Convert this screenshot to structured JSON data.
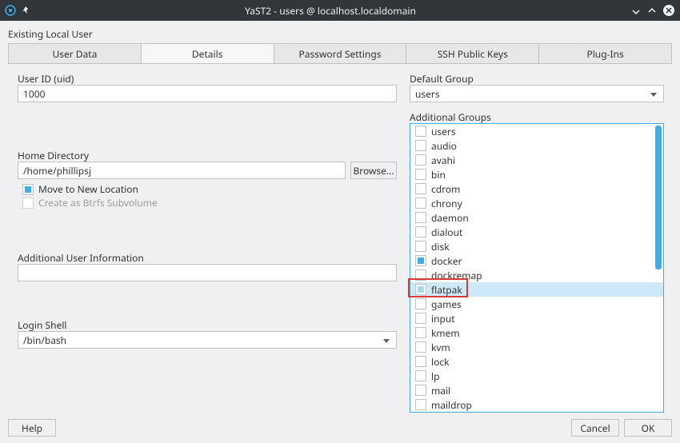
{
  "window": {
    "title": "YaST2 - users @ localhost.localdomain"
  },
  "header": "Existing Local User",
  "tabs": [
    "User Data",
    "Details",
    "Password Settings",
    "SSH Public Keys",
    "Plug-Ins"
  ],
  "activeTab": 1,
  "uid": {
    "label": "User ID (uid)",
    "value": "1000"
  },
  "home": {
    "label": "Home Directory",
    "value": "/home/phillipsj",
    "browse": "Browse...",
    "moveLabel": "Move to New Location",
    "btrfsLabel": "Create as Btrfs Subvolume"
  },
  "additionalInfo": {
    "label": "Additional User Information",
    "value": ""
  },
  "loginShell": {
    "label": "Login Shell",
    "value": "/bin/bash"
  },
  "defaultGroup": {
    "label": "Default Group",
    "value": "users"
  },
  "additionalGroups": {
    "label": "Additional Groups",
    "items": [
      {
        "name": "users",
        "state": ""
      },
      {
        "name": "audio",
        "state": ""
      },
      {
        "name": "avahi",
        "state": ""
      },
      {
        "name": "bin",
        "state": ""
      },
      {
        "name": "cdrom",
        "state": ""
      },
      {
        "name": "chrony",
        "state": ""
      },
      {
        "name": "daemon",
        "state": ""
      },
      {
        "name": "dialout",
        "state": ""
      },
      {
        "name": "disk",
        "state": ""
      },
      {
        "name": "docker",
        "state": "checked"
      },
      {
        "name": "dockremap",
        "state": ""
      },
      {
        "name": "flatpak",
        "state": "partial",
        "selected": true
      },
      {
        "name": "games",
        "state": ""
      },
      {
        "name": "input",
        "state": ""
      },
      {
        "name": "kmem",
        "state": ""
      },
      {
        "name": "kvm",
        "state": ""
      },
      {
        "name": "lock",
        "state": ""
      },
      {
        "name": "lp",
        "state": ""
      },
      {
        "name": "mail",
        "state": ""
      },
      {
        "name": "maildrop",
        "state": ""
      }
    ]
  },
  "buttons": {
    "help": "Help",
    "cancel": "Cancel",
    "ok": "OK"
  }
}
